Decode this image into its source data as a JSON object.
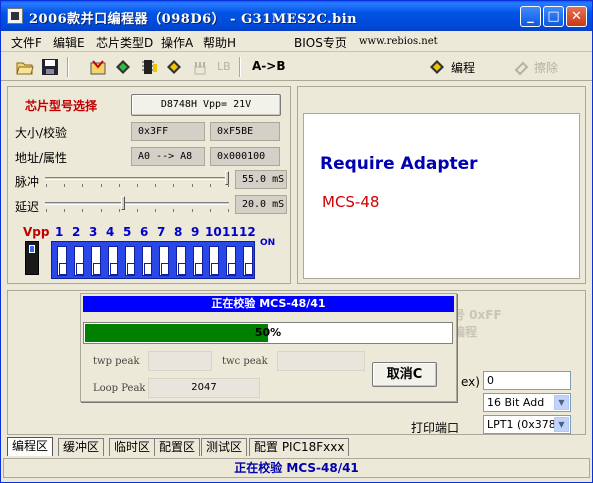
{
  "window": {
    "title": "2006款并口编程器（098D6） - G31MES2C.bin",
    "min_label": "_",
    "max_label": "□",
    "close_label": "✕"
  },
  "menu": {
    "file": "文件F",
    "edit": "编辑E",
    "chip_type": "芯片类型D",
    "operate": "操作A",
    "help": "帮助H",
    "bios": "BIOS专页",
    "website": "www.rebios.net"
  },
  "toolbar": {
    "lb_label": "LB",
    "ab_label": "A->B",
    "program_label": "编程",
    "erase_label": "擦除"
  },
  "chip": {
    "heading": "芯片型号选择",
    "selected": "D8748H  Vpp= 21V",
    "size_label": "大小/校验",
    "size_value": "0x3FF",
    "checksum_value": "0xF5BE",
    "addr_label": "地址/属性",
    "addr_value": "A0 --> A8",
    "attr_value": "0x000100",
    "pulse_label": "脉冲",
    "pulse_value": "55.0 mS",
    "pulse_level": 1.0,
    "delay_label": "延迟",
    "delay_value": "20.0 mS",
    "delay_level": 0.42
  },
  "dip": {
    "vpp_label": "Vpp",
    "numbers": [
      "1",
      "2",
      "3",
      "4",
      "5",
      "6",
      "7",
      "8",
      "9",
      "10",
      "11",
      "12"
    ],
    "on_label": "ON"
  },
  "adapter": {
    "title": "Require Adapter",
    "model": "MCS-48"
  },
  "dialog": {
    "title": "正在校验 MCS-48/41",
    "progress_text": "50%",
    "progress": 0.5,
    "twp_label": "twp peak",
    "twc_label": "twc peak",
    "loop_label": "Loop Peak",
    "loop_value": "2047",
    "cancel_label": "取消C"
  },
  "lower": {
    "partial_ff": "号 0xFF",
    "partial_prog": "编程",
    "hex_suffix": "ex)",
    "hex_value": "0",
    "bit_mode": "16 Bit Add",
    "port_label": "打印端口",
    "port_value": "LPT1 (0x378)"
  },
  "tabs": [
    "编程区",
    "缓冲区",
    "临时区",
    "配置区",
    "测试区",
    "配置 PIC18Fxxx"
  ],
  "status": "正在校验 MCS-48/41"
}
